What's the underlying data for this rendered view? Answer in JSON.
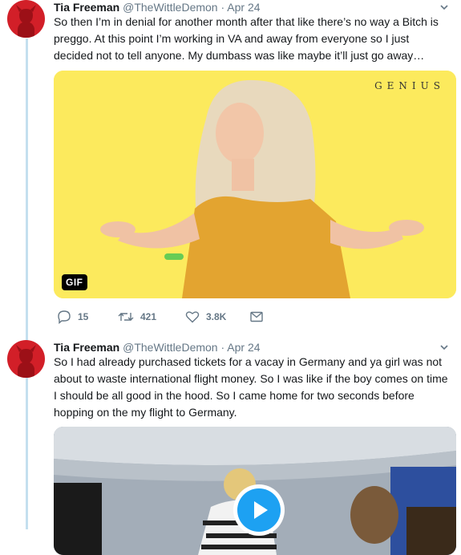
{
  "colors": {
    "accent": "#1da1f2",
    "thread_line": "#c4dfef",
    "gif_bg": "#fcea5d",
    "avatar": "#d21f28"
  },
  "tweets": [
    {
      "name": "Tia Freeman",
      "handle": "@TheWittleDemon",
      "separator": "·",
      "date": "Apr 24",
      "text": "So then I’m in denial for another month after that like there’s no way a Bitch is preggo. At this point I’m working in VA and away from everyone so I just decided not to tell anyone. My dumbass was like maybe it’ll just go away…",
      "media": {
        "type": "gif",
        "badge": "GIF",
        "watermark": "GENIUS"
      },
      "actions": {
        "replies": "15",
        "retweets": "421",
        "likes": "3.8K"
      }
    },
    {
      "name": "Tia Freeman",
      "handle": "@TheWittleDemon",
      "separator": "·",
      "date": "Apr 24",
      "text": "So I had already purchased tickets for a vacay in Germany and ya girl was not about to waste international flight money. So I was like if the boy comes on time I should be all good in the hood. So I came home for two seconds before hopping on the my flight to Germany.",
      "media": {
        "type": "video"
      }
    }
  ]
}
